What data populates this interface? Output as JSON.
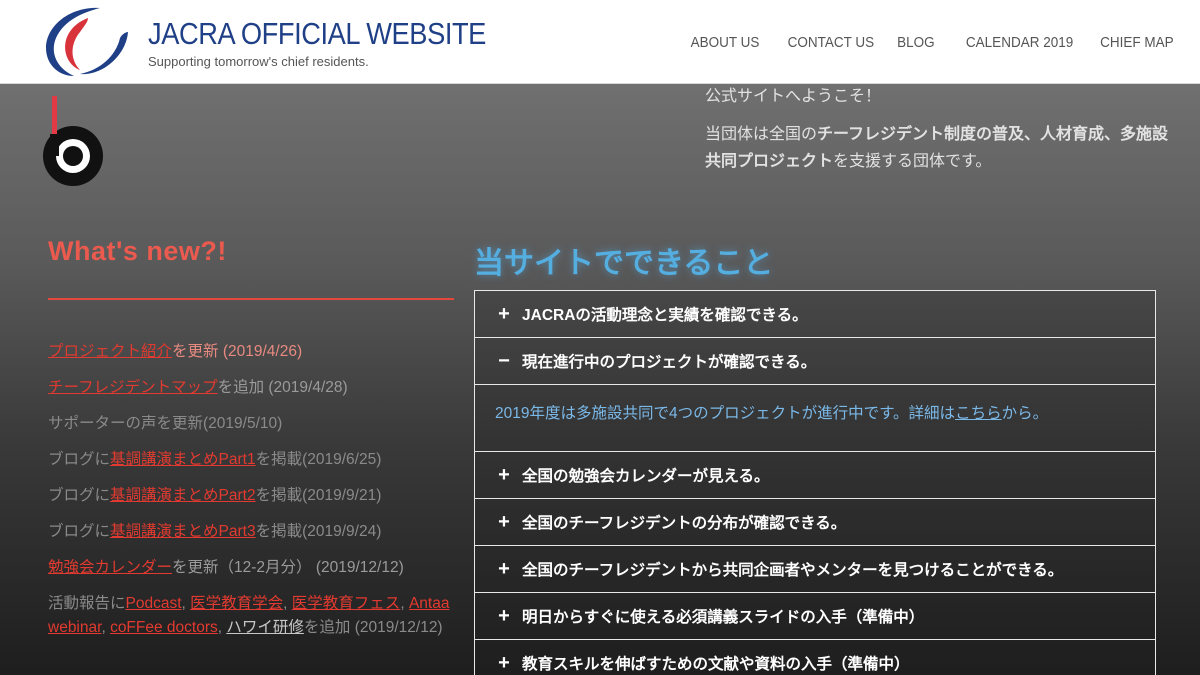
{
  "header": {
    "title": "JACRA OFFICIAL WEBSITE",
    "tagline": "Supporting tomorrow's chief residents.",
    "nav": [
      "ABOUT US",
      "CONTACT US",
      "BLOG",
      "CALENDAR 2019",
      "CHIEF MAP"
    ]
  },
  "welcome": {
    "line1": "公式サイトへようこそ！",
    "line2_a": "当団体は全国の",
    "line2_b": "チーフレジデント制度の普及、人材育成、多施設共同プロジェクト",
    "line2_c": "を支援する団体です。"
  },
  "news": {
    "title": "What's new?!",
    "items": [
      {
        "link": "プロジェクト紹介",
        "rest": "を更新 (2019/4/26)"
      },
      {
        "link": "チーフレジデントマップ",
        "rest": "を追加 (2019/4/28)"
      },
      {
        "text": "サポーターの声を更新(2019/5/10)"
      },
      {
        "pre": "ブログに",
        "link": "基調講演まとめPart1",
        "rest": "を掲載(2019/6/25)"
      },
      {
        "pre": "ブログに",
        "link": "基調講演まとめPart2",
        "rest": "を掲載(2019/9/21)"
      },
      {
        "pre": "ブログに",
        "link": "基調講演まとめPart3",
        "rest": "を掲載(2019/9/24)"
      },
      {
        "link": "勉強会カレンダー",
        "rest": "を更新（12-2月分） (2019/12/12)"
      }
    ],
    "last": {
      "pre": "活動報告に",
      "links": [
        "Podcast",
        "医学教育学会",
        "医学教育フェス",
        "Antaa webinar",
        "coFFee doctors",
        "ハワイ研修"
      ],
      "rest": "を追加 (2019/12/12)"
    }
  },
  "features": {
    "title": "当サイトでできること",
    "items": [
      {
        "sign": "+",
        "label": "JACRAの活動理念と実績を確認できる。"
      },
      {
        "sign": "−",
        "label": "現在進行中のプロジェクトが確認できる。"
      },
      {
        "sign": "+",
        "label": "全国の勉強会カレンダーが見える。"
      },
      {
        "sign": "+",
        "label": "全国のチーフレジデントの分布が確認できる。"
      },
      {
        "sign": "+",
        "label": "全国のチーフレジデントから共同企画者やメンターを見つけることができる。"
      },
      {
        "sign": "+",
        "label": "明日からすぐに使える必須講義スライドの入手（準備中）"
      },
      {
        "sign": "+",
        "label": "教育スキルを伸ばすための文献や資料の入手（準備中）"
      }
    ],
    "panel": {
      "text": "2019年度は多施設共同で4つのプロジェクトが進行中です。詳細は",
      "link": "こちら",
      "rest": "から。"
    }
  },
  "colors": {
    "brand": "#1f3f86",
    "accent_red": "#e4473c",
    "accent_blue": "#55aee0"
  }
}
